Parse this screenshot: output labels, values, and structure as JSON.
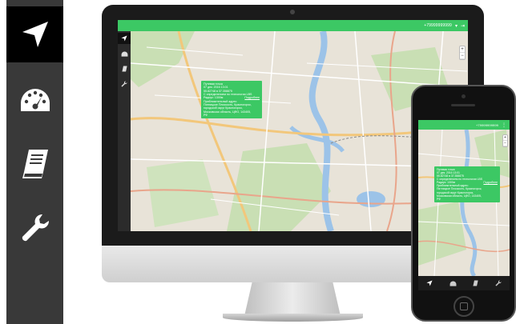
{
  "sidebar": {
    "items": [
      {
        "icon": "navigation-arrow-icon",
        "active": true
      },
      {
        "icon": "speedometer-icon",
        "active": false
      },
      {
        "icon": "book-icon",
        "active": false
      },
      {
        "icon": "wrench-icon",
        "active": false
      }
    ]
  },
  "app": {
    "phone_number": "+79999999999",
    "caret": "▾",
    "exit": "⇥",
    "zoom_in": "+",
    "zoom_out": "−",
    "popup": {
      "title": "Путевая точка",
      "date": "07 дек. 2016 13:01",
      "coords": "55.82748 в 37.358875",
      "status": "С определением по технологии LBS",
      "radius": "Радиус: 1300м",
      "radius_link": "Подробнее",
      "address_label": "Приблизительный адрес:",
      "address_1": "Пятницкое Плоскость, Красногорск,",
      "address_2": "городской округ Красногорск,",
      "address_3": "Московская область, ЦФО, 143405,",
      "address_4": "РФ"
    }
  },
  "colors": {
    "accent_green": "#3cc864",
    "sidebar_bg": "#393939",
    "sidebar_active": "#000000"
  }
}
